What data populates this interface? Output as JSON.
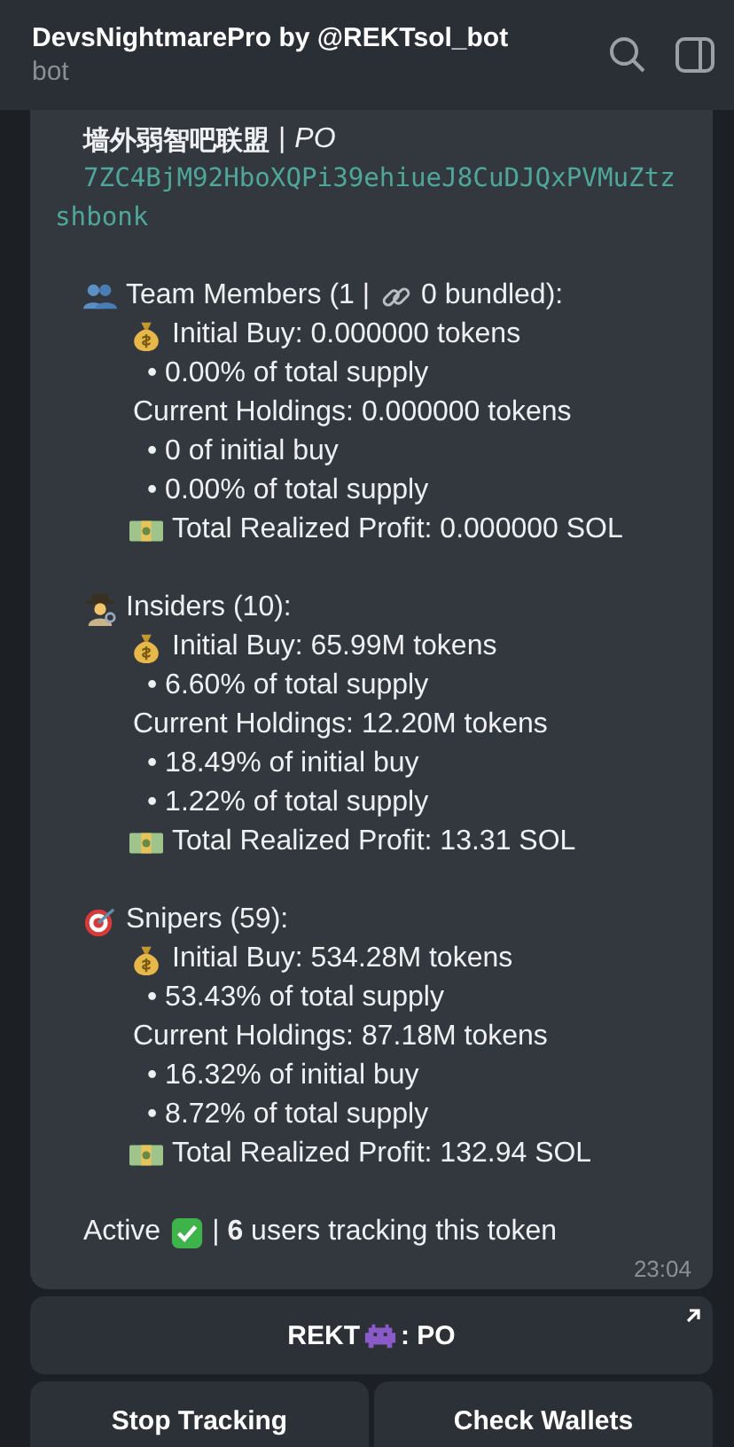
{
  "header": {
    "title": "DevsNightmarePro by @REKTsol_bot",
    "subtitle": "bot"
  },
  "message": {
    "token_name": "墙外弱智吧联盟",
    "separator": "|",
    "token_symbol": "PO",
    "address": "7ZC4BjM92HboXQPi39ehiueJ8CuDJQxPVMuZtzshbonk",
    "sections": [
      {
        "kind": "team",
        "title": "Team Members (1 |",
        "title_after_link": "0 bundled):",
        "lines": [
          {
            "kind": "buy",
            "text": "Initial Buy: 0.000000 tokens"
          },
          {
            "kind": "bullet",
            "text": "• 0.00% of total supply"
          },
          {
            "kind": "holdings",
            "text": "Current Holdings: 0.000000 tokens"
          },
          {
            "kind": "bullet",
            "text": "• 0 of initial buy"
          },
          {
            "kind": "bullet",
            "text": "• 0.00% of total supply"
          },
          {
            "kind": "profit",
            "text": "Total Realized Profit: 0.000000 SOL"
          }
        ]
      },
      {
        "kind": "insiders",
        "title": "Insiders (10):",
        "lines": [
          {
            "kind": "buy",
            "text": "Initial Buy: 65.99M tokens"
          },
          {
            "kind": "bullet",
            "text": "• 6.60% of total supply"
          },
          {
            "kind": "holdings",
            "text": "Current Holdings: 12.20M tokens"
          },
          {
            "kind": "bullet",
            "text": "• 18.49% of initial buy"
          },
          {
            "kind": "bullet",
            "text": "• 1.22% of total supply"
          },
          {
            "kind": "profit",
            "text": "Total Realized Profit: 13.31 SOL"
          }
        ]
      },
      {
        "kind": "snipers",
        "title": "Snipers (59):",
        "lines": [
          {
            "kind": "buy",
            "text": "Initial Buy: 534.28M tokens"
          },
          {
            "kind": "bullet",
            "text": "• 53.43% of total supply"
          },
          {
            "kind": "holdings",
            "text": "Current Holdings: 87.18M tokens"
          },
          {
            "kind": "bullet",
            "text": "• 16.32% of initial buy"
          },
          {
            "kind": "bullet",
            "text": "• 8.72% of total supply"
          },
          {
            "kind": "profit",
            "text": "Total Realized Profit: 132.94 SOL"
          }
        ]
      }
    ],
    "status": "Active",
    "tracking": "| **6** users tracking this token",
    "time": "23:04"
  },
  "buttons": {
    "main_before": "REKT",
    "main_after": ": PO",
    "row": [
      "Stop Tracking",
      "Check Wallets"
    ]
  }
}
